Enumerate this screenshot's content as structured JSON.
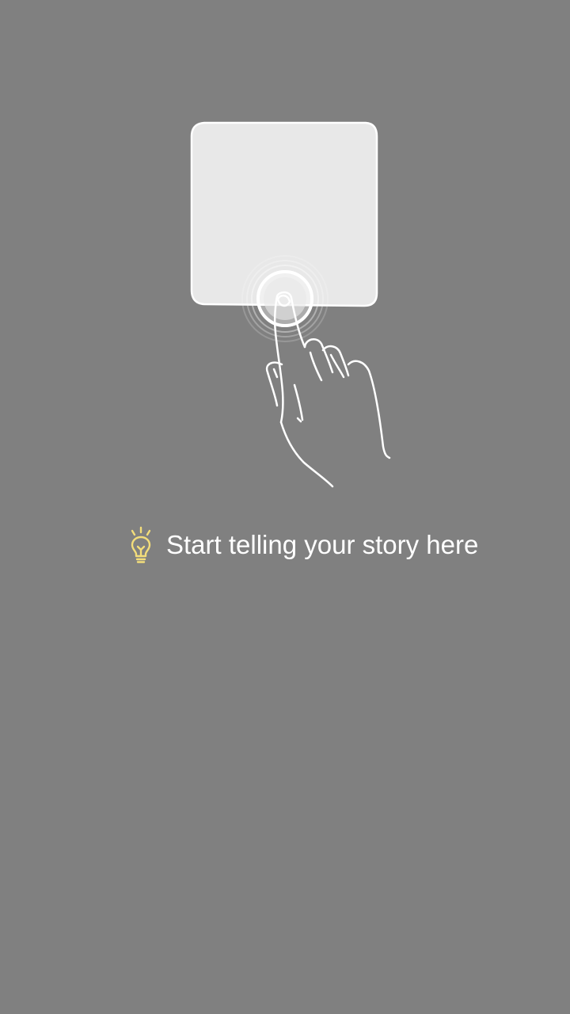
{
  "tutorial": {
    "hint_text": "Start telling your story here",
    "hint_icon": "lightbulb-icon",
    "hint_icon_color": "#f3dd7a",
    "overlay_color": "#808080",
    "card_color": "#e8e8e8"
  }
}
